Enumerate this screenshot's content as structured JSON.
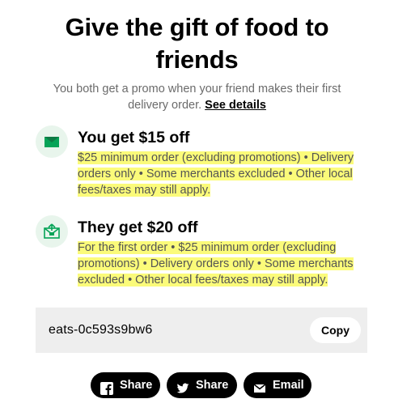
{
  "header": {
    "title": "Give the gift of food to friends",
    "subtitle": "You both get a promo when your friend makes their first delivery order.",
    "details_link": "See details"
  },
  "benefits": [
    {
      "icon": "envelope-icon",
      "title": "You get $15 off",
      "description": "$25 minimum order (excluding promotions) • Delivery orders only • Some merchants excluded • Other local fees/taxes may still apply."
    },
    {
      "icon": "gift-envelope-icon",
      "title": "They get $20 off",
      "description": "For the first order • $25 minimum order (excluding promotions) • Delivery orders only • Some merchants excluded • Other local fees/taxes may still apply."
    }
  ],
  "referral": {
    "code": "eats-0c593s9bw6",
    "copy_label": "Copy"
  },
  "share": {
    "facebook": {
      "icon": "facebook-icon",
      "label": "Share"
    },
    "twitter": {
      "icon": "twitter-icon",
      "label": "Share"
    },
    "email": {
      "icon": "email-icon",
      "label": "Email"
    }
  },
  "colors": {
    "highlight": "#fbfb7a",
    "icon_bg": "#e8f5ec",
    "icon_green": "#05a357",
    "code_box_bg": "#eeeeee",
    "button_bg": "#000000"
  }
}
